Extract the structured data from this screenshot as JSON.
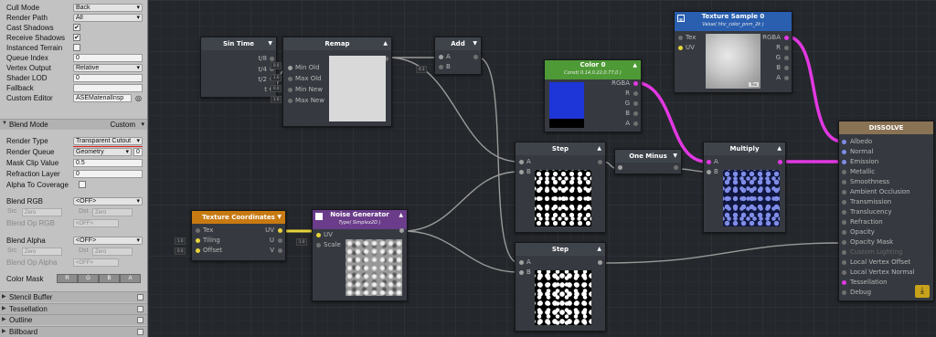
{
  "inspector": {
    "rows": [
      {
        "label": "Cull Mode",
        "kind": "dropdown",
        "value": "Back"
      },
      {
        "label": "Render Path",
        "kind": "dropdown",
        "value": "All"
      },
      {
        "label": "Cast Shadows",
        "kind": "check",
        "value": "✔"
      },
      {
        "label": "Receive Shadows",
        "kind": "check",
        "value": "✔"
      },
      {
        "label": "Instanced Terrain",
        "kind": "check",
        "value": ""
      },
      {
        "label": "Queue Index",
        "kind": "text",
        "value": "0"
      },
      {
        "label": "Vertex Output",
        "kind": "dropdown",
        "value": "Relative"
      },
      {
        "label": "Shader LOD",
        "kind": "text",
        "value": "0"
      },
      {
        "label": "Fallback",
        "kind": "text",
        "value": ""
      },
      {
        "label": "Custom Editor",
        "kind": "text",
        "value": "ASEMaterialInsp"
      }
    ],
    "blend_mode_header": "Blend Mode",
    "blend_mode_value": "Custom",
    "render_type_label": "Render Type",
    "render_type_value": "Transparent Cutout",
    "render_queue_label": "Render Queue",
    "render_queue_value": "Geometry",
    "mask_clip_label": "Mask Clip Value",
    "mask_clip_value": "0.5",
    "refraction_label": "Refraction Layer",
    "refraction_value": "0",
    "alpha_cov_label": "Alpha To Coverage",
    "blend_rgb_label": "Blend RGB",
    "blend_rgb_value": "<OFF>",
    "src_label": "Src",
    "dst_label": "Dst",
    "zero": "Zero",
    "blend_op_rgb_label": "Blend Op RGB",
    "blend_op_value": "<OFF>",
    "blend_alpha_label": "Blend Alpha",
    "blend_alpha_value": "<OFF>",
    "blend_op_alpha_label": "Blend Op Alpha",
    "color_mask_label": "Color Mask",
    "color_mask": [
      "R",
      "G",
      "B",
      "A"
    ],
    "sections": [
      "Stencil Buffer",
      "Tessellation",
      "Outline",
      "Billboard"
    ]
  },
  "nodes": {
    "sin_time": {
      "title": "Sin Time",
      "outputs": [
        "t/8",
        "t/4",
        "t/2",
        "t"
      ]
    },
    "remap": {
      "title": "Remap",
      "inputs": [
        "Min Old",
        "Max Old",
        "Min New",
        "Max New"
      ],
      "tags": [
        "0.0",
        "1.0",
        "0.0",
        "1.0"
      ]
    },
    "add": {
      "title": "Add",
      "inputs": [
        "A",
        "B"
      ],
      "tag": "0.3"
    },
    "color0": {
      "title": "Color 0",
      "subtitle": "Const( 0.14,0.22,0.77,0 )",
      "outputs": [
        "RGBA",
        "R",
        "G",
        "B",
        "A"
      ],
      "color": "#1e35d8"
    },
    "texture_sample": {
      "title": "Texture Sample 0",
      "subtitle": "Value( hhc_color_pnrn_2k )",
      "inputs": [
        "Tex",
        "UV"
      ],
      "outputs": [
        "RGBA",
        "R",
        "G",
        "B",
        "A"
      ],
      "badge": "Tex"
    },
    "dissolve": {
      "title": "DISSOLVE",
      "inputs": [
        "Albedo",
        "Normal",
        "Emission",
        "Metallic",
        "Smoothness",
        "Ambient Occlusion",
        "Transmission",
        "Translucency",
        "Refraction",
        "Opacity",
        "Opacity Mask",
        "Custom Lighting",
        "Local Vertex Offset",
        "Local Vertex Normal",
        "Tessellation",
        "Debug"
      ]
    },
    "step1": {
      "title": "Step",
      "inputs": [
        "A",
        "B"
      ]
    },
    "step2": {
      "title": "Step",
      "inputs": [
        "A",
        "B"
      ]
    },
    "one_minus": {
      "title": "One Minus"
    },
    "multiply": {
      "title": "Multiply",
      "inputs": [
        "A",
        "B"
      ]
    },
    "texcoords": {
      "title": "Texture Coordinates",
      "inputs": [
        "Tex",
        "Tiling",
        "Offset"
      ],
      "outputs": [
        "UV",
        "U",
        "V"
      ],
      "tags": [
        "1.0",
        "0.0"
      ]
    },
    "noise": {
      "title": "Noise Generator",
      "subtitle": "Type( Simplex2D )",
      "inputs": [
        "UV",
        "Scale"
      ],
      "tag": "1.0"
    }
  },
  "colors": {
    "wire_pink": "#e238e2",
    "wire_yellow": "#e8d43a",
    "wire_gray": "#8c8c8c",
    "header_green": "#4e9a36",
    "header_orange": "#c87a12",
    "header_purple": "#6a3c8a",
    "header_blue": "#2a5fb0",
    "header_tan": "#8a7354"
  }
}
